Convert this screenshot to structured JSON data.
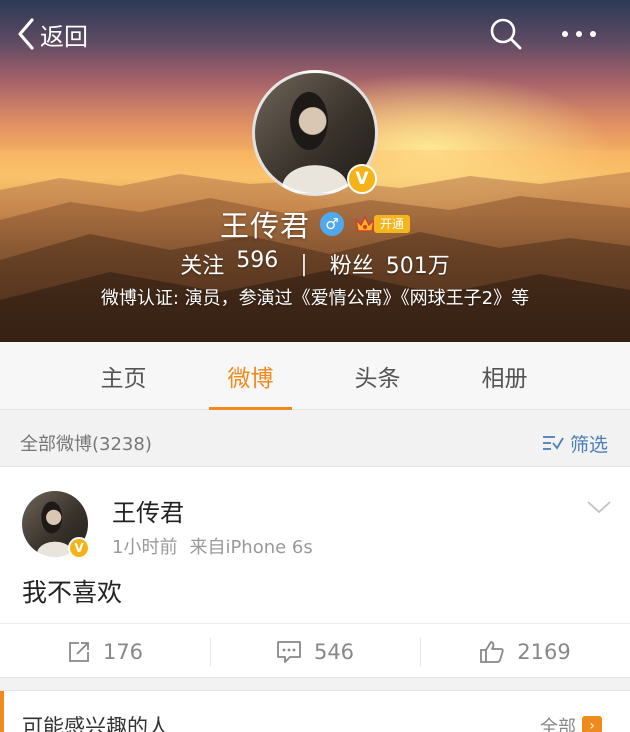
{
  "header": {
    "back_label": "返回",
    "profile_name": "王传君",
    "gender_symbol": "♂",
    "vip_label": "开通",
    "verified_badge": "V",
    "following_label": "关注",
    "following_count": "596",
    "stats_separator": "|",
    "followers_label": "粉丝",
    "followers_count": "501万",
    "verification": "微博认证: 演员，参演过《爱情公寓》《网球王子2》等"
  },
  "tabs": [
    {
      "label": "主页",
      "active": false
    },
    {
      "label": "微博",
      "active": true
    },
    {
      "label": "头条",
      "active": false
    },
    {
      "label": "相册",
      "active": false
    }
  ],
  "filter_bar": {
    "count_label": "全部微博(3238)",
    "filter_label": "筛选"
  },
  "post": {
    "author": "王传君",
    "verified_badge": "V",
    "time": "1小时前",
    "source": "来自iPhone 6s",
    "text": "我不喜欢",
    "reposts": "176",
    "comments": "546",
    "likes": "2169"
  },
  "recommend": {
    "title": "可能感兴趣的人",
    "all_label": "全部",
    "arrow": "›"
  },
  "icons": [
    "chevron-left-icon",
    "search-icon",
    "more-icon",
    "crown-icon",
    "filter-icon",
    "chevron-down-icon",
    "repost-icon",
    "comment-icon",
    "like-icon"
  ],
  "colors": {
    "accent": "#f08a1c",
    "verified": "#f6b317",
    "link": "#4a7fb8",
    "gender": "#4fa9ea"
  }
}
